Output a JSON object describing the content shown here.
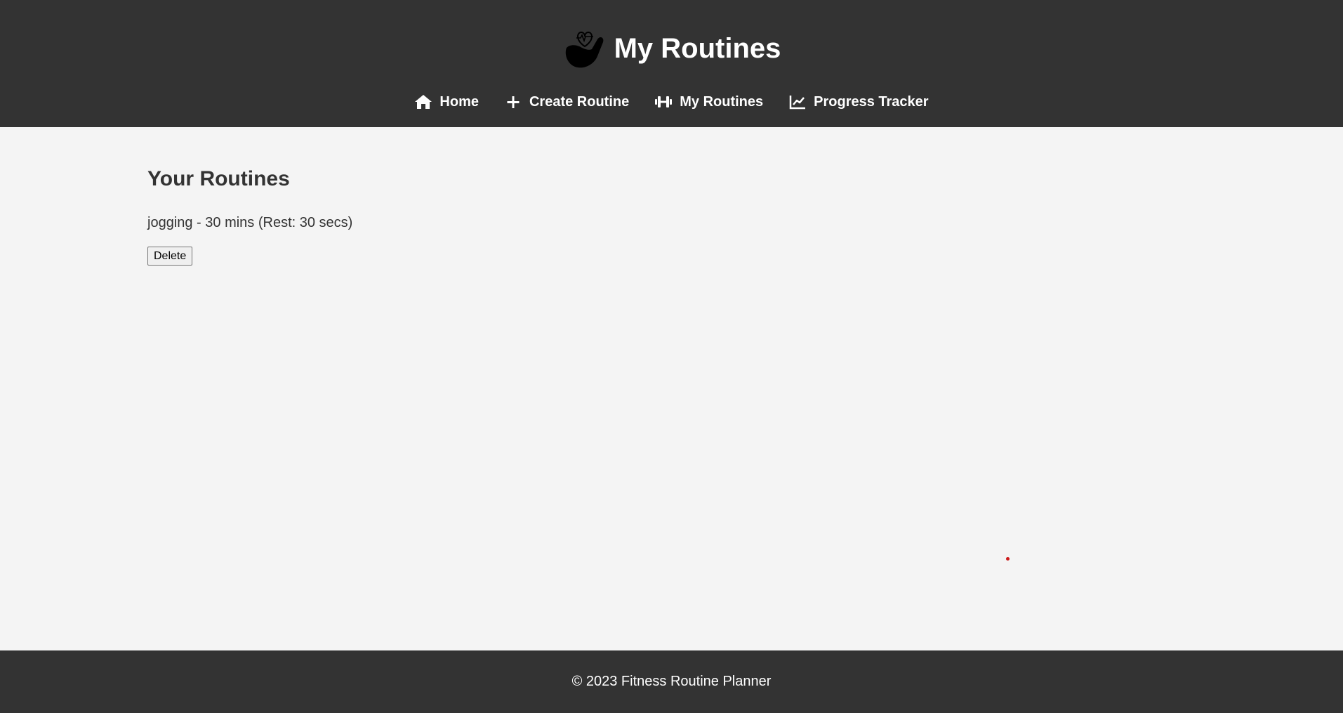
{
  "header": {
    "title": "My Routines",
    "logo_icon": "flexed-arm-heart-icon"
  },
  "nav": {
    "items": [
      {
        "label": "Home",
        "icon": "home-icon"
      },
      {
        "label": "Create Routine",
        "icon": "plus-icon"
      },
      {
        "label": "My Routines",
        "icon": "dumbbell-icon"
      },
      {
        "label": "Progress Tracker",
        "icon": "chart-line-icon"
      }
    ]
  },
  "main": {
    "heading": "Your Routines",
    "routines": [
      {
        "text": "jogging - 30 mins (Rest: 30 secs)",
        "delete_label": "Delete"
      }
    ]
  },
  "footer": {
    "text": "© 2023 Fitness Routine Planner"
  },
  "colors": {
    "header_bg": "#333333",
    "page_bg": "#f4f4f4",
    "text": "#333333",
    "header_text": "#ffffff"
  }
}
